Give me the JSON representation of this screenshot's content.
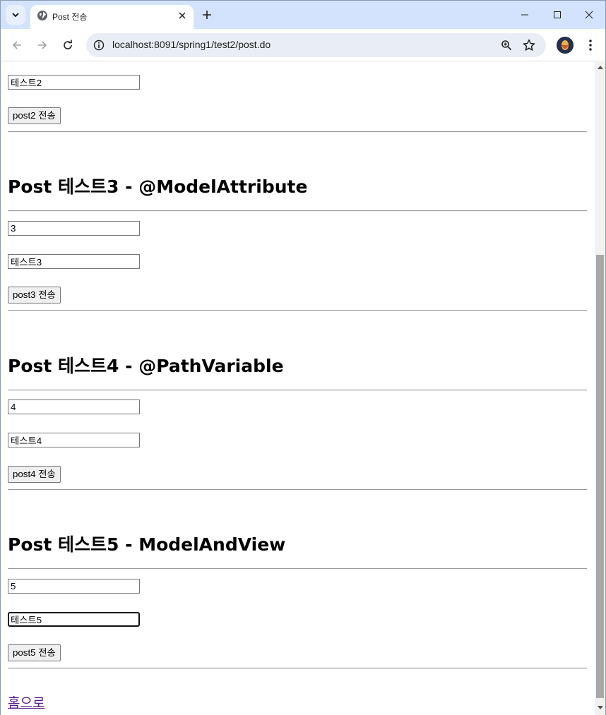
{
  "browser": {
    "tab_title": "Post 전송",
    "url": "localhost:8091/spring1/test2/post.do",
    "accent_color": "#d3e3fd"
  },
  "icons": {
    "tab_search": "chevron-down-icon",
    "favicon": "globe-icon",
    "tab_close": "close-icon",
    "new_tab": "plus-icon",
    "minimize": "minimize-icon",
    "maximize": "maximize-icon",
    "close_window": "close-icon",
    "back": "back-arrow-icon",
    "forward": "forward-arrow-icon",
    "reload": "reload-icon",
    "site_info": "site-info-icon",
    "zoom": "zoom-icon",
    "bookmark": "star-icon",
    "menu": "more-vert-icon"
  },
  "page": {
    "section2": {
      "name_value": "테스트2",
      "button_label": "post2 전송"
    },
    "section3": {
      "heading": "Post 테스트3 - @ModelAttribute",
      "id_value": "3",
      "name_value": "테스트3",
      "button_label": "post3 전송"
    },
    "section4": {
      "heading": "Post 테스트4 - @PathVariable",
      "id_value": "4",
      "name_value": "테스트4",
      "button_label": "post4 전송"
    },
    "section5": {
      "heading": "Post 테스트5 - ModelAndView",
      "id_value": "5",
      "name_value": "테스트5",
      "button_label": "post5 전송"
    },
    "home_link": "홈으로"
  }
}
